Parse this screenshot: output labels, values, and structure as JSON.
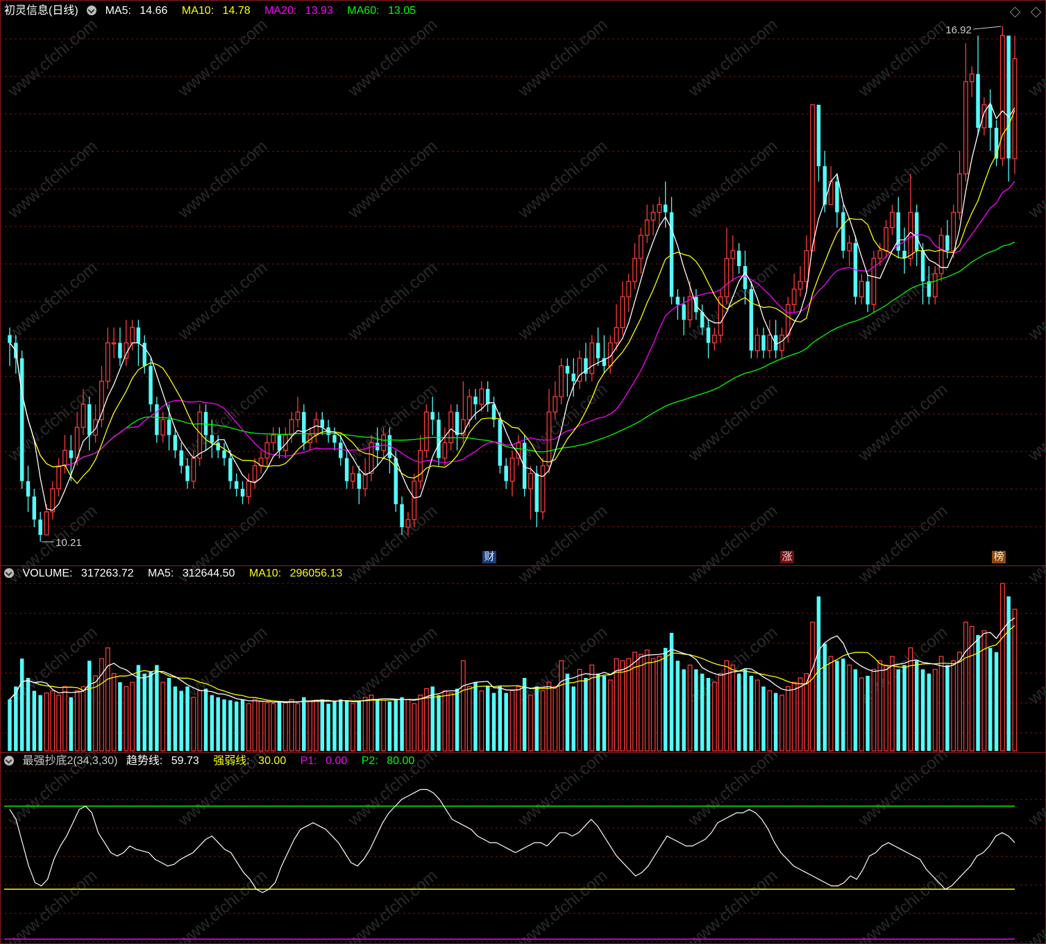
{
  "stock": {
    "name": "初灵信息",
    "period": "(日线)"
  },
  "price_header": {
    "ma5": {
      "label": "MA5:",
      "value": "14.66",
      "color": "#ffffff"
    },
    "ma10": {
      "label": "MA10:",
      "value": "14.78",
      "color": "#ffff00"
    },
    "ma20": {
      "label": "MA20:",
      "value": "13.93",
      "color": "#ff00ff"
    },
    "ma60": {
      "label": "MA60:",
      "value": "13.05",
      "color": "#00ff00"
    }
  },
  "volume_header": {
    "volume": {
      "label": "VOLUME:",
      "value": "317263.72",
      "color": "#ffffff"
    },
    "ma5": {
      "label": "MA5:",
      "value": "312644.50",
      "color": "#ffffff"
    },
    "ma10": {
      "label": "MA10:",
      "value": "296056.13",
      "color": "#ffff00"
    }
  },
  "indicator_header": {
    "name": "最强抄底2(34,3,30)",
    "trend": {
      "label": "趋势线:",
      "value": "59.73",
      "color": "#ffffff"
    },
    "strength": {
      "label": "强弱线:",
      "value": "30.00",
      "color": "#ffff00"
    },
    "p1": {
      "label": "P1:",
      "value": "0.00",
      "color": "#ff00ff"
    },
    "p2": {
      "label": "P2:",
      "value": "80.00",
      "color": "#00ff00"
    }
  },
  "markers": {
    "cai": "财",
    "zhang": "涨",
    "bang": "榜"
  },
  "watermark": "www.cfchi.com",
  "colors": {
    "up": "#ff3b3b",
    "down": "#54fcfc",
    "grid": "#7a1414",
    "border": "#8b1a1a"
  },
  "chart_data": {
    "type": "candlestick",
    "panels": [
      "price",
      "volume",
      "indicator"
    ],
    "price_range": [
      10.21,
      16.92
    ],
    "annotations": {
      "high_label": "16.92",
      "low_label": "10.21"
    },
    "candles": [
      [
        12.9,
        12.8,
        13.0,
        12.5,
        120000
      ],
      [
        12.8,
        12.6,
        12.9,
        12.4,
        150000
      ],
      [
        12.6,
        11.0,
        12.7,
        10.9,
        215000
      ],
      [
        11.0,
        10.8,
        11.2,
        10.6,
        170000
      ],
      [
        10.8,
        10.5,
        10.9,
        10.4,
        140000
      ],
      [
        10.5,
        10.3,
        10.6,
        10.21,
        130000
      ],
      [
        10.3,
        10.6,
        10.7,
        10.3,
        135000
      ],
      [
        10.6,
        10.9,
        11.0,
        10.5,
        140000
      ],
      [
        10.9,
        11.2,
        11.3,
        10.8,
        130000
      ],
      [
        11.2,
        11.4,
        11.6,
        11.1,
        150000
      ],
      [
        11.4,
        11.3,
        11.6,
        11.0,
        125000
      ],
      [
        11.3,
        11.7,
        11.9,
        11.2,
        140000
      ],
      [
        11.7,
        12.0,
        12.2,
        11.6,
        150000
      ],
      [
        12.0,
        11.6,
        12.1,
        11.4,
        210000
      ],
      [
        11.6,
        11.8,
        12.0,
        11.5,
        175000
      ],
      [
        11.8,
        12.3,
        12.5,
        11.7,
        215000
      ],
      [
        12.3,
        12.8,
        13.0,
        12.2,
        240000
      ],
      [
        12.8,
        12.8,
        13.0,
        12.6,
        180000
      ],
      [
        12.8,
        12.6,
        13.0,
        12.5,
        160000
      ],
      [
        12.6,
        12.8,
        13.1,
        12.5,
        150000
      ],
      [
        12.8,
        13.0,
        13.1,
        12.7,
        160000
      ],
      [
        13.0,
        12.8,
        13.1,
        12.5,
        200000
      ],
      [
        12.8,
        12.5,
        12.9,
        12.4,
        180000
      ],
      [
        12.5,
        12.0,
        12.6,
        11.9,
        185000
      ],
      [
        12.0,
        11.6,
        12.1,
        11.5,
        200000
      ],
      [
        11.6,
        11.8,
        11.9,
        11.5,
        160000
      ],
      [
        11.8,
        11.6,
        12.0,
        11.4,
        170000
      ],
      [
        11.6,
        11.4,
        11.7,
        11.3,
        150000
      ],
      [
        11.4,
        11.2,
        11.5,
        11.1,
        140000
      ],
      [
        11.2,
        11.0,
        11.3,
        10.9,
        150000
      ],
      [
        11.0,
        11.3,
        11.4,
        10.9,
        125000
      ],
      [
        11.3,
        11.9,
        12.0,
        11.2,
        140000
      ],
      [
        11.9,
        11.6,
        12.0,
        11.4,
        145000
      ],
      [
        11.6,
        11.5,
        11.8,
        11.3,
        130000
      ],
      [
        11.5,
        11.4,
        11.6,
        11.3,
        125000
      ],
      [
        11.4,
        11.3,
        11.5,
        11.2,
        120000
      ],
      [
        11.3,
        11.0,
        11.4,
        10.9,
        118000
      ],
      [
        11.0,
        10.9,
        11.1,
        10.8,
        115000
      ],
      [
        10.9,
        10.8,
        11.0,
        10.7,
        120000
      ],
      [
        10.8,
        11.0,
        11.1,
        10.7,
        110000
      ],
      [
        11.0,
        11.2,
        11.3,
        10.9,
        120000
      ],
      [
        11.2,
        11.3,
        11.4,
        11.1,
        115000
      ],
      [
        11.3,
        11.5,
        11.6,
        11.2,
        112000
      ],
      [
        11.5,
        11.6,
        11.7,
        11.4,
        110000
      ],
      [
        11.6,
        11.4,
        11.7,
        11.3,
        115000
      ],
      [
        11.4,
        11.6,
        11.7,
        11.3,
        112000
      ],
      [
        11.6,
        11.8,
        11.9,
        11.5,
        120000
      ],
      [
        11.8,
        11.9,
        12.1,
        11.7,
        110000
      ],
      [
        11.9,
        11.5,
        12.0,
        11.4,
        125000
      ],
      [
        11.5,
        11.6,
        11.7,
        11.4,
        115000
      ],
      [
        11.6,
        11.8,
        11.9,
        11.5,
        118000
      ],
      [
        11.8,
        11.7,
        11.9,
        11.6,
        120000
      ],
      [
        11.7,
        11.6,
        11.8,
        11.5,
        110000
      ],
      [
        11.6,
        11.5,
        11.7,
        11.4,
        115000
      ],
      [
        11.5,
        11.3,
        11.6,
        11.2,
        120000
      ],
      [
        11.3,
        11.0,
        11.4,
        10.9,
        118000
      ],
      [
        11.0,
        11.1,
        11.2,
        10.9,
        110000
      ],
      [
        11.1,
        10.9,
        11.2,
        10.7,
        115000
      ],
      [
        10.9,
        11.1,
        11.3,
        10.8,
        125000
      ],
      [
        11.1,
        11.5,
        11.6,
        11.0,
        130000
      ],
      [
        11.5,
        11.4,
        11.7,
        11.2,
        120000
      ],
      [
        11.4,
        11.6,
        11.7,
        11.3,
        118000
      ],
      [
        11.6,
        11.3,
        11.7,
        11.1,
        115000
      ],
      [
        11.3,
        10.7,
        11.4,
        10.6,
        120000
      ],
      [
        10.7,
        10.4,
        10.8,
        10.3,
        125000
      ],
      [
        10.4,
        10.5,
        10.6,
        10.3,
        120000
      ],
      [
        10.5,
        11.0,
        11.1,
        10.4,
        110000
      ],
      [
        11.0,
        11.4,
        11.6,
        10.9,
        130000
      ],
      [
        11.4,
        11.9,
        12.0,
        11.3,
        145000
      ],
      [
        11.9,
        11.8,
        12.1,
        11.6,
        150000
      ],
      [
        11.8,
        11.3,
        11.9,
        11.2,
        130000
      ],
      [
        11.3,
        11.5,
        11.7,
        11.2,
        140000
      ],
      [
        11.5,
        11.9,
        12.0,
        11.4,
        135000
      ],
      [
        11.9,
        11.6,
        12.0,
        11.4,
        145000
      ],
      [
        11.6,
        11.8,
        12.3,
        11.5,
        210000
      ],
      [
        11.8,
        12.1,
        12.2,
        11.7,
        150000
      ],
      [
        12.1,
        12.0,
        12.2,
        11.8,
        160000
      ],
      [
        12.0,
        12.2,
        12.3,
        11.9,
        140000
      ],
      [
        12.2,
        12.0,
        12.3,
        11.9,
        150000
      ],
      [
        12.0,
        11.8,
        12.1,
        11.7,
        135000
      ],
      [
        11.8,
        11.2,
        11.9,
        11.1,
        150000
      ],
      [
        11.2,
        11.0,
        11.3,
        10.9,
        135000
      ],
      [
        11.0,
        11.3,
        11.4,
        10.8,
        140000
      ],
      [
        11.3,
        11.5,
        11.6,
        11.2,
        150000
      ],
      [
        11.5,
        10.9,
        11.6,
        10.8,
        170000
      ],
      [
        10.9,
        11.1,
        11.2,
        10.5,
        130000
      ],
      [
        11.1,
        10.6,
        11.2,
        10.4,
        150000
      ],
      [
        10.6,
        11.2,
        11.3,
        10.5,
        140000
      ],
      [
        11.2,
        11.9,
        12.2,
        11.1,
        160000
      ],
      [
        11.9,
        12.1,
        12.3,
        11.8,
        150000
      ],
      [
        12.1,
        12.5,
        12.6,
        12.0,
        210000
      ],
      [
        12.5,
        12.4,
        12.6,
        12.1,
        180000
      ],
      [
        12.4,
        12.3,
        12.6,
        12.1,
        150000
      ],
      [
        12.3,
        12.6,
        12.7,
        12.2,
        190000
      ],
      [
        12.6,
        12.4,
        12.8,
        12.3,
        170000
      ],
      [
        12.4,
        12.8,
        12.9,
        12.3,
        200000
      ],
      [
        12.8,
        12.6,
        13.0,
        12.5,
        180000
      ],
      [
        12.6,
        12.5,
        12.9,
        12.4,
        175000
      ],
      [
        12.5,
        12.8,
        12.9,
        12.4,
        165000
      ],
      [
        12.8,
        13.0,
        13.3,
        12.7,
        215000
      ],
      [
        13.0,
        13.4,
        13.6,
        12.9,
        210000
      ],
      [
        13.4,
        13.6,
        13.7,
        13.2,
        215000
      ],
      [
        13.6,
        13.9,
        14.1,
        13.5,
        230000
      ],
      [
        13.9,
        14.2,
        14.3,
        13.7,
        225000
      ],
      [
        14.2,
        14.4,
        14.6,
        14.1,
        235000
      ],
      [
        14.4,
        14.5,
        14.6,
        14.2,
        215000
      ],
      [
        14.5,
        14.6,
        14.7,
        14.3,
        220000
      ],
      [
        14.6,
        14.5,
        14.9,
        14.3,
        240000
      ],
      [
        14.5,
        13.4,
        14.7,
        13.3,
        275000
      ],
      [
        13.4,
        13.3,
        13.5,
        13.1,
        210000
      ],
      [
        13.3,
        13.1,
        13.4,
        12.9,
        190000
      ],
      [
        13.1,
        13.4,
        13.6,
        13.0,
        200000
      ],
      [
        13.4,
        13.2,
        13.5,
        13.1,
        190000
      ],
      [
        13.2,
        13.0,
        13.3,
        12.9,
        180000
      ],
      [
        13.0,
        12.8,
        13.1,
        12.6,
        170000
      ],
      [
        12.8,
        12.9,
        13.0,
        12.7,
        160000
      ],
      [
        12.9,
        13.4,
        13.5,
        12.8,
        180000
      ],
      [
        13.4,
        13.9,
        14.3,
        13.3,
        210000
      ],
      [
        13.9,
        14.0,
        14.2,
        13.6,
        200000
      ],
      [
        14.0,
        13.8,
        14.1,
        13.7,
        180000
      ],
      [
        13.8,
        13.5,
        14.0,
        13.3,
        190000
      ],
      [
        13.5,
        12.7,
        13.6,
        12.6,
        175000
      ],
      [
        12.7,
        12.9,
        13.0,
        12.6,
        165000
      ],
      [
        12.9,
        12.7,
        13.0,
        12.6,
        150000
      ],
      [
        12.7,
        12.9,
        13.1,
        12.6,
        140000
      ],
      [
        12.9,
        12.7,
        13.1,
        12.6,
        135000
      ],
      [
        12.7,
        12.9,
        13.0,
        12.6,
        130000
      ],
      [
        12.9,
        13.3,
        13.4,
        12.8,
        150000
      ],
      [
        13.3,
        13.5,
        13.7,
        13.2,
        160000
      ],
      [
        13.5,
        13.6,
        13.8,
        13.4,
        170000
      ],
      [
        13.6,
        14.0,
        14.2,
        13.5,
        180000
      ],
      [
        14.0,
        15.9,
        15.9,
        14.0,
        300000
      ],
      [
        15.9,
        15.1,
        15.5,
        14.9,
        360000
      ],
      [
        15.1,
        14.6,
        15.3,
        14.5,
        250000
      ],
      [
        14.6,
        14.9,
        15.1,
        14.6,
        220000
      ],
      [
        14.9,
        14.5,
        15.0,
        14.3,
        210000
      ],
      [
        14.5,
        14.0,
        14.6,
        13.9,
        215000
      ],
      [
        14.0,
        14.1,
        14.2,
        13.8,
        200000
      ],
      [
        14.1,
        13.4,
        14.2,
        13.3,
        190000
      ],
      [
        13.4,
        13.6,
        13.7,
        13.3,
        170000
      ],
      [
        13.6,
        13.3,
        13.7,
        13.2,
        175000
      ],
      [
        13.3,
        13.9,
        14.0,
        13.2,
        190000
      ],
      [
        13.9,
        14.0,
        14.1,
        13.8,
        210000
      ],
      [
        14.0,
        14.3,
        14.4,
        13.9,
        200000
      ],
      [
        14.3,
        14.5,
        14.6,
        14.2,
        220000
      ],
      [
        14.5,
        14.0,
        14.7,
        13.9,
        190000
      ],
      [
        14.0,
        13.9,
        14.3,
        13.7,
        200000
      ],
      [
        13.9,
        14.5,
        15.0,
        13.8,
        240000
      ],
      [
        14.5,
        14.0,
        14.6,
        13.8,
        210000
      ],
      [
        14.0,
        13.6,
        14.1,
        13.3,
        190000
      ],
      [
        13.6,
        13.4,
        13.8,
        13.3,
        180000
      ],
      [
        13.4,
        13.7,
        13.8,
        13.3,
        190000
      ],
      [
        13.7,
        14.2,
        14.3,
        13.6,
        220000
      ],
      [
        14.2,
        14.0,
        14.4,
        13.9,
        200000
      ],
      [
        14.0,
        14.5,
        14.6,
        13.9,
        210000
      ],
      [
        14.5,
        15.0,
        15.3,
        14.4,
        230000
      ],
      [
        15.0,
        16.2,
        16.7,
        14.9,
        300000
      ],
      [
        16.2,
        16.3,
        16.4,
        16.0,
        290000
      ],
      [
        16.3,
        15.6,
        16.8,
        15.5,
        270000
      ],
      [
        15.6,
        15.9,
        16.0,
        15.5,
        280000
      ],
      [
        15.9,
        15.6,
        16.1,
        15.3,
        240000
      ],
      [
        15.6,
        15.2,
        15.7,
        15.1,
        230000
      ],
      [
        15.2,
        16.8,
        16.92,
        15.1,
        390000
      ],
      [
        16.8,
        15.2,
        16.7,
        14.9,
        360000
      ],
      [
        15.2,
        16.5,
        16.8,
        15.0,
        330000
      ]
    ],
    "indicator": {
      "trend": [
        78,
        72,
        58,
        44,
        34,
        32,
        36,
        48,
        56,
        62,
        70,
        78,
        80,
        76,
        64,
        58,
        52,
        50,
        52,
        56,
        54,
        53,
        52,
        48,
        46,
        44,
        45,
        48,
        50,
        52,
        56,
        60,
        62,
        58,
        54,
        52,
        46,
        40,
        36,
        30,
        28,
        30,
        34,
        44,
        52,
        60,
        66,
        68,
        70,
        68,
        66,
        62,
        58,
        52,
        46,
        44,
        48,
        54,
        62,
        70,
        76,
        80,
        84,
        86,
        88,
        90,
        90,
        88,
        84,
        78,
        72,
        70,
        68,
        66,
        62,
        60,
        58,
        58,
        56,
        54,
        52,
        54,
        56,
        58,
        58,
        56,
        60,
        64,
        64,
        62,
        64,
        68,
        72,
        68,
        62,
        56,
        50,
        46,
        42,
        38,
        40,
        44,
        50,
        56,
        62,
        60,
        58,
        56,
        56,
        58,
        60,
        64,
        70,
        72,
        74,
        76,
        76,
        78,
        76,
        72,
        66,
        58,
        52,
        48,
        44,
        42,
        40,
        38,
        36,
        34,
        32,
        32,
        34,
        38,
        36,
        42,
        50,
        52,
        56,
        58,
        56,
        54,
        52,
        50,
        48,
        42,
        38,
        34,
        30,
        32,
        36,
        40,
        44,
        50,
        52,
        56,
        62,
        64,
        62,
        58
      ],
      "strength": 30,
      "p1": 0,
      "p2": 80
    }
  }
}
